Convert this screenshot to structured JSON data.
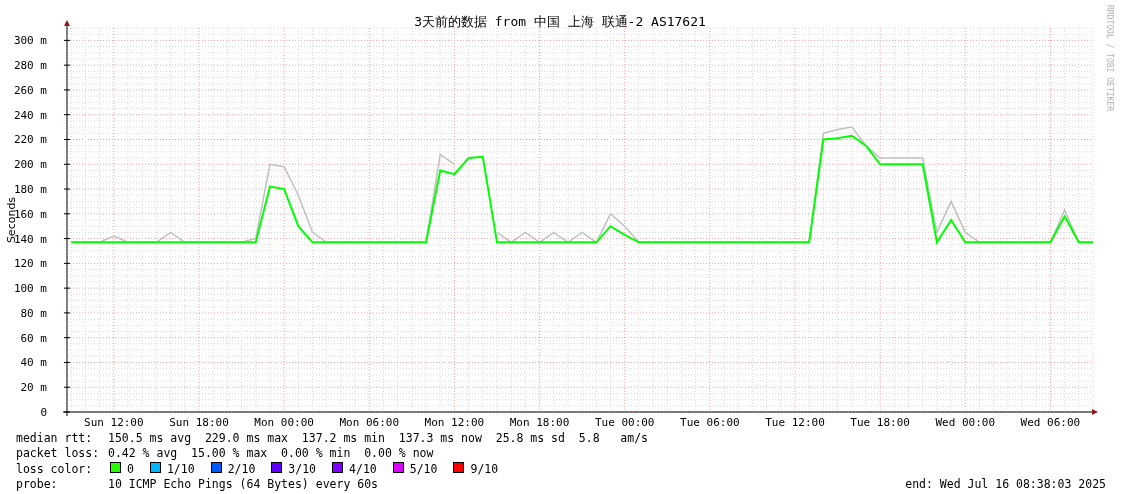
{
  "chart": {
    "watermark": "RRDTOOL / TOBI OETIKER",
    "chart_data": {
      "type": "line",
      "title": "3天前的数据 from 中国 上海 联通-2 AS17621",
      "ylabel": "Seconds",
      "ylim": [
        0,
        310
      ],
      "grid": true,
      "categories": [
        null,
        null,
        null,
        "Sun 12:00",
        null,
        null,
        null,
        null,
        null,
        "Sun 18:00",
        null,
        null,
        null,
        null,
        null,
        "Mon 00:00",
        null,
        null,
        null,
        null,
        null,
        "Mon 06:00",
        null,
        null,
        null,
        null,
        null,
        "Mon 12:00",
        null,
        null,
        null,
        null,
        null,
        "Mon 18:00",
        null,
        null,
        null,
        null,
        null,
        "Tue 00:00",
        null,
        null,
        null,
        null,
        null,
        "Tue 06:00",
        null,
        null,
        null,
        null,
        null,
        "Tue 12:00",
        null,
        null,
        null,
        null,
        null,
        "Tue 18:00",
        null,
        null,
        null,
        null,
        null,
        "Wed 00:00",
        null,
        null,
        null,
        null,
        null,
        "Wed 06:00",
        null,
        null,
        null
      ],
      "series": [
        {
          "color": "#c0c0c0",
          "values": [
            137,
            137,
            137,
            142,
            137,
            137,
            137,
            145,
            137,
            137,
            137,
            137,
            137,
            140,
            200,
            198,
            175,
            145,
            137,
            137,
            137,
            137,
            137,
            137,
            137,
            137,
            208,
            200,
            null,
            null,
            145,
            137,
            145,
            137,
            145,
            137,
            145,
            137,
            160,
            150,
            137,
            137,
            137,
            137,
            137,
            137,
            137,
            137,
            137,
            137,
            137,
            137,
            137,
            225,
            228,
            230,
            215,
            205,
            205,
            205,
            205,
            145,
            170,
            145,
            137,
            137,
            137,
            137,
            137,
            137,
            163,
            137,
            137
          ]
        },
        {
          "color": "#00ff00",
          "values": [
            137,
            137,
            137,
            137,
            137,
            137,
            137,
            137,
            137,
            137,
            137,
            137,
            137,
            137,
            182,
            180,
            150,
            137,
            137,
            137,
            137,
            137,
            137,
            137,
            137,
            137,
            195,
            192,
            205,
            206,
            137,
            137,
            137,
            137,
            137,
            137,
            137,
            137,
            150,
            143,
            137,
            137,
            137,
            137,
            137,
            137,
            137,
            137,
            137,
            137,
            137,
            137,
            137,
            220,
            221,
            223,
            215,
            200,
            200,
            200,
            200,
            137,
            155,
            137,
            137,
            137,
            137,
            137,
            137,
            137,
            158,
            137,
            137
          ]
        }
      ],
      "yticks": [
        {
          "value": 0,
          "label": "0"
        },
        {
          "value": 20,
          "label": "20 m"
        },
        {
          "value": 40,
          "label": "40 m"
        },
        {
          "value": 60,
          "label": "60 m"
        },
        {
          "value": 80,
          "label": "80 m"
        },
        {
          "value": 100,
          "label": "100 m"
        },
        {
          "value": 120,
          "label": "120 m"
        },
        {
          "value": 140,
          "label": "140 m"
        },
        {
          "value": 160,
          "label": "160 m"
        },
        {
          "value": 180,
          "label": "180 m"
        },
        {
          "value": 200,
          "label": "200 m"
        },
        {
          "value": 220,
          "label": "220 m"
        },
        {
          "value": 240,
          "label": "240 m"
        },
        {
          "value": 260,
          "label": "260 m"
        },
        {
          "value": 280,
          "label": "280 m"
        },
        {
          "value": 300,
          "label": "300 m"
        }
      ]
    }
  },
  "legend": {
    "median_rtt": {
      "label": "median rtt:",
      "text": "150.5 ms avg  229.0 ms max  137.2 ms min  137.3 ms now  25.8 ms sd  5.8   am/s"
    },
    "packet_loss": {
      "label": "packet loss:",
      "text": "0.42 % avg  15.00 % max  0.00 % min  0.00 % now"
    },
    "loss_color": {
      "label": "loss color:",
      "items": [
        {
          "label": "0",
          "color": "#26ff00"
        },
        {
          "label": "1/10",
          "color": "#00b8ff"
        },
        {
          "label": "2/10",
          "color": "#0059ff"
        },
        {
          "label": "3/10",
          "color": "#5e00ff"
        },
        {
          "label": "4/10",
          "color": "#7e00ff"
        },
        {
          "label": "5/10",
          "color": "#dd00ff"
        },
        {
          "label": "9/10",
          "color": "#ff0000"
        }
      ]
    },
    "probe": {
      "label": "probe:",
      "text": "10 ICMP Echo Pings (64 Bytes) every 60s"
    },
    "end": "end: Wed Jul 16 08:38:03 2025"
  }
}
